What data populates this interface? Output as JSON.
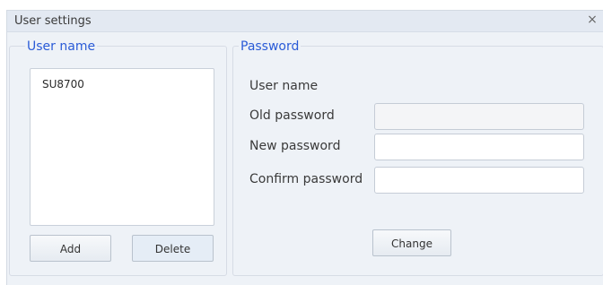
{
  "window": {
    "title": "User settings",
    "close_glyph": "×"
  },
  "user_group": {
    "title": "User name",
    "users": [
      "SU8700"
    ],
    "add_label": "Add",
    "delete_label": "Delete"
  },
  "password_group": {
    "title": "Password",
    "user_name_label": "User name",
    "old_password_label": "Old password",
    "new_password_label": "New password",
    "confirm_password_label": "Confirm password",
    "old_password_value": "",
    "new_password_value": "",
    "confirm_password_value": "",
    "change_label": "Change"
  }
}
